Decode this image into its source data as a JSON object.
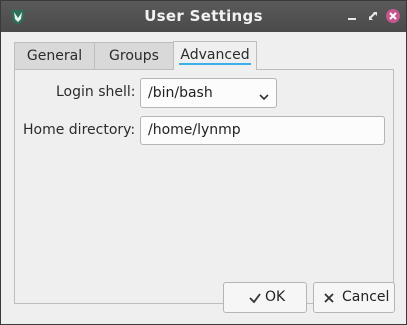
{
  "window": {
    "title": "User Settings"
  },
  "tabs": [
    {
      "label": "General",
      "active": false
    },
    {
      "label": "Groups",
      "active": false
    },
    {
      "label": "Advanced",
      "active": true
    }
  ],
  "advanced": {
    "login_shell_label": "Login shell:",
    "login_shell_value": "/bin/bash",
    "home_directory_label": "Home directory:",
    "home_directory_value": "/home/lynmp"
  },
  "buttons": {
    "ok": "OK",
    "cancel": "Cancel"
  },
  "colors": {
    "titlebar": "#4f4f4f",
    "accent": "#3daee9",
    "close": "#c6568f"
  },
  "icons": {
    "app": "shield-logo-icon",
    "minimize": "minimize-icon",
    "maximize": "maximize-icon",
    "close": "close-icon",
    "combo": "chevron-down-icon",
    "ok": "checkmark-icon",
    "cancel": "x-icon"
  }
}
